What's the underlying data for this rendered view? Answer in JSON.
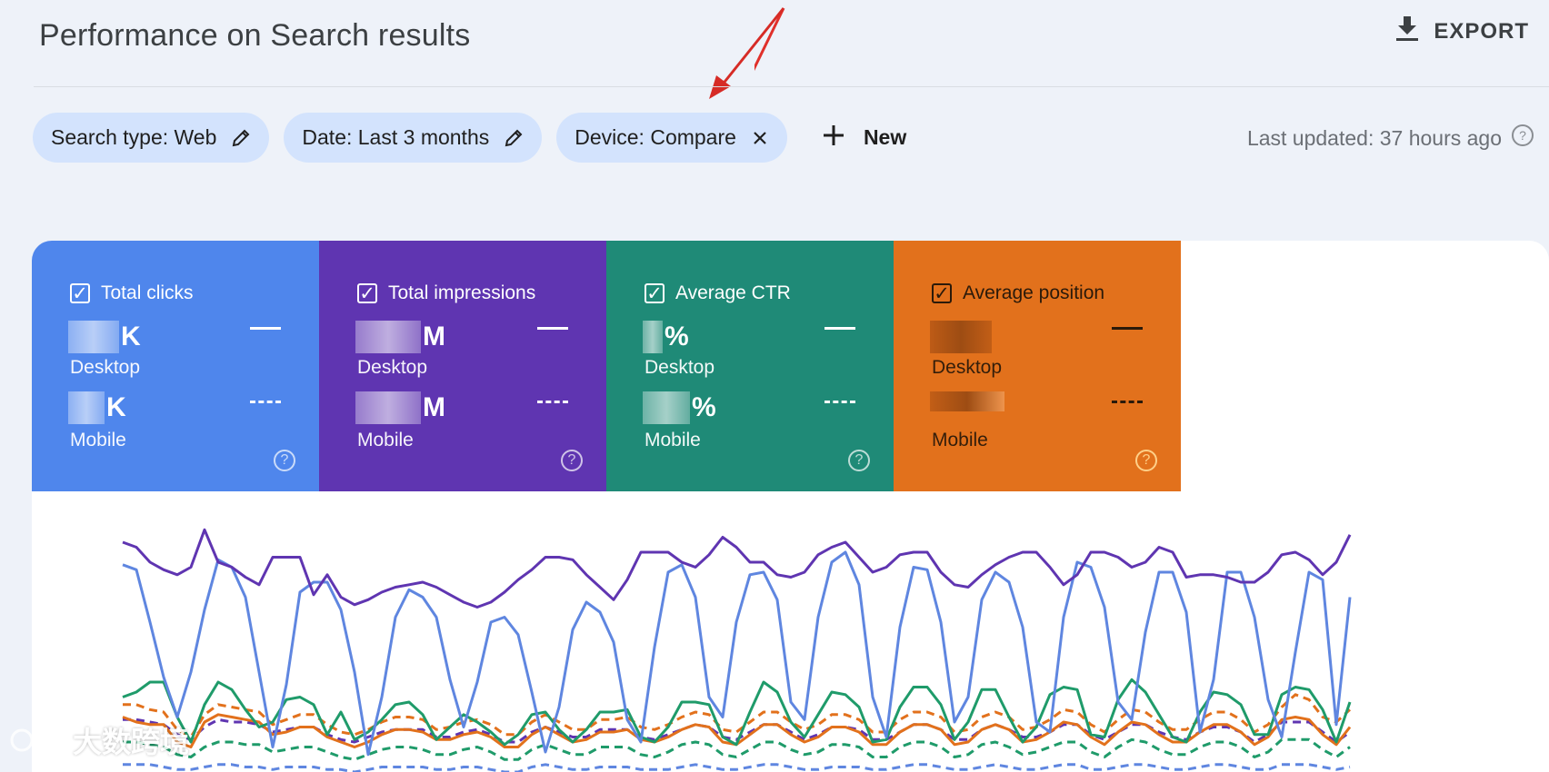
{
  "header": {
    "title": "Performance on Search results",
    "export_label": "EXPORT"
  },
  "filters": {
    "chips": [
      {
        "label": "Search type: Web",
        "icon": "pencil-icon"
      },
      {
        "label": "Date: Last 3 months",
        "icon": "pencil-icon"
      },
      {
        "label": "Device: Compare",
        "icon": "close-icon"
      }
    ],
    "new_label": "New",
    "last_updated": "Last updated: 37 hours ago"
  },
  "metrics": [
    {
      "label": "Total clicks",
      "desktop_suffix": "K",
      "mobile_suffix": "K",
      "desktop_label": "Desktop",
      "mobile_label": "Mobile",
      "color": "#4f86ec"
    },
    {
      "label": "Total impressions",
      "desktop_suffix": "M",
      "mobile_suffix": "M",
      "desktop_label": "Desktop",
      "mobile_label": "Mobile",
      "color": "#5f35b1"
    },
    {
      "label": "Average CTR",
      "desktop_suffix": "%",
      "mobile_suffix": "%",
      "desktop_label": "Desktop",
      "mobile_label": "Mobile",
      "color": "#1f8a77"
    },
    {
      "label": "Average position",
      "desktop_suffix": "",
      "mobile_suffix": "",
      "desktop_label": "Desktop",
      "mobile_label": "Mobile",
      "color": "#e2711c"
    }
  ],
  "watermark": "大数跨境",
  "chart_data": {
    "type": "line",
    "x": [
      1,
      2,
      3,
      4,
      5,
      6,
      7,
      8,
      9,
      10,
      11,
      12,
      13,
      14,
      15,
      16,
      17,
      18,
      19,
      20,
      21,
      22,
      23,
      24,
      25,
      26,
      27,
      28,
      29,
      30,
      31,
      32,
      33,
      34,
      35,
      36,
      37,
      38,
      39,
      40,
      41,
      42,
      43,
      44,
      45,
      46,
      47,
      48,
      49,
      50,
      51,
      52,
      53,
      54,
      55,
      56,
      57,
      58,
      59,
      60,
      61,
      62,
      63,
      64,
      65,
      66,
      67,
      68,
      69,
      70,
      71,
      72,
      73,
      74,
      75,
      76,
      77,
      78,
      79,
      80,
      81,
      82,
      83,
      84,
      85,
      86,
      87,
      88,
      89,
      90,
      91
    ],
    "series": [
      {
        "color": "#5f35b1",
        "dashed": false,
        "values": [
          92,
          90,
          84,
          81,
          79,
          82,
          97,
          84,
          82,
          78,
          75,
          86,
          86,
          86,
          71,
          79,
          70,
          67,
          69,
          72,
          74,
          75,
          76,
          74,
          71,
          68,
          66,
          68,
          72,
          77,
          81,
          86,
          86,
          85,
          79,
          74,
          69,
          77,
          88,
          88,
          88,
          84,
          82,
          87,
          94,
          90,
          84,
          84,
          79,
          78,
          80,
          87,
          90,
          92,
          86,
          80,
          82,
          87,
          88,
          88,
          80,
          75,
          74,
          79,
          83,
          86,
          88,
          88,
          82,
          75,
          79,
          88,
          88,
          86,
          82,
          84,
          90,
          88,
          78,
          79,
          79,
          78,
          76,
          76,
          80,
          87,
          88,
          85,
          79,
          84,
          95
        ]
      },
      {
        "color": "#5f86e0",
        "dashed": false,
        "values": [
          83,
          81,
          60,
          38,
          22,
          40,
          65,
          85,
          82,
          70,
          40,
          10,
          35,
          72,
          76,
          76,
          65,
          40,
          7,
          30,
          62,
          73,
          70,
          62,
          37,
          18,
          36,
          60,
          62,
          55,
          32,
          8,
          26,
          57,
          68,
          64,
          52,
          21,
          12,
          50,
          80,
          83,
          70,
          30,
          22,
          60,
          79,
          80,
          69,
          28,
          21,
          62,
          84,
          88,
          75,
          30,
          14,
          58,
          82,
          81,
          60,
          20,
          30,
          69,
          80,
          76,
          58,
          20,
          16,
          62,
          84,
          82,
          66,
          28,
          21,
          56,
          80,
          80,
          64,
          16,
          37,
          80,
          80,
          62,
          29,
          14,
          48,
          80,
          77,
          19,
          70
        ]
      },
      {
        "color": "#1f9b6a",
        "dashed": false,
        "values": [
          30,
          32,
          36,
          36,
          22,
          12,
          27,
          36,
          33,
          25,
          18,
          20,
          29,
          30,
          27,
          15,
          24,
          13,
          16,
          21,
          27,
          28,
          23,
          13,
          18,
          23,
          20,
          16,
          11,
          15,
          23,
          24,
          17,
          12,
          17,
          24,
          24,
          25,
          14,
          12,
          18,
          28,
          28,
          27,
          14,
          11,
          24,
          36,
          32,
          20,
          14,
          23,
          32,
          31,
          26,
          12,
          13,
          26,
          34,
          34,
          27,
          13,
          20,
          33,
          33,
          22,
          12,
          18,
          31,
          34,
          33,
          15,
          14,
          29,
          37,
          32,
          23,
          14,
          12,
          24,
          32,
          31,
          27,
          15,
          15,
          31,
          34,
          33,
          25,
          12,
          28
        ]
      },
      {
        "color": "#e2711c",
        "dashed": false,
        "values": [
          22,
          20,
          19,
          19,
          12,
          10,
          20,
          23,
          22,
          21,
          20,
          15,
          16,
          18,
          18,
          14,
          12,
          10,
          12,
          15,
          17,
          17,
          16,
          13,
          13,
          15,
          16,
          14,
          10,
          10,
          15,
          18,
          15,
          12,
          13,
          16,
          16,
          17,
          13,
          12,
          14,
          17,
          19,
          18,
          12,
          11,
          15,
          19,
          19,
          15,
          12,
          14,
          18,
          18,
          16,
          11,
          11,
          16,
          19,
          19,
          17,
          11,
          12,
          17,
          19,
          17,
          12,
          13,
          16,
          20,
          19,
          14,
          11,
          16,
          20,
          19,
          15,
          12,
          12,
          16,
          19,
          19,
          16,
          11,
          14,
          21,
          22,
          21,
          15,
          11,
          18
        ]
      },
      {
        "color": "#e2711c",
        "dashed": true,
        "values": [
          27,
          27,
          25,
          24,
          17,
          14,
          23,
          27,
          26,
          25,
          24,
          19,
          21,
          23,
          23,
          19,
          16,
          15,
          17,
          20,
          22,
          22,
          21,
          17,
          18,
          20,
          21,
          19,
          15,
          15,
          20,
          23,
          20,
          17,
          17,
          21,
          21,
          22,
          18,
          17,
          19,
          22,
          24,
          23,
          17,
          16,
          20,
          24,
          24,
          20,
          17,
          19,
          23,
          23,
          21,
          16,
          16,
          21,
          24,
          24,
          22,
          16,
          17,
          22,
          24,
          22,
          17,
          18,
          21,
          25,
          24,
          19,
          16,
          21,
          25,
          24,
          20,
          17,
          17,
          21,
          24,
          24,
          21,
          16,
          19,
          26,
          31,
          29,
          22,
          20,
          25
        ]
      },
      {
        "color": "#5f35b1",
        "dashed": true,
        "values": [
          21,
          21,
          20,
          19,
          15,
          13,
          18,
          21,
          20,
          20,
          19,
          16,
          17,
          18,
          18,
          15,
          13,
          12,
          14,
          16,
          17,
          17,
          17,
          14,
          14,
          16,
          17,
          15,
          12,
          12,
          16,
          18,
          16,
          14,
          14,
          17,
          17,
          17,
          14,
          13,
          15,
          17,
          19,
          18,
          14,
          13,
          16,
          19,
          19,
          16,
          13,
          15,
          18,
          18,
          17,
          13,
          13,
          16,
          19,
          19,
          17,
          13,
          13,
          17,
          19,
          17,
          14,
          14,
          16,
          19,
          19,
          15,
          13,
          16,
          19,
          19,
          16,
          14,
          13,
          16,
          18,
          18,
          16,
          12,
          15,
          20,
          20,
          20,
          16,
          12,
          16
        ]
      },
      {
        "color": "#1f9b6a",
        "dashed": true,
        "values": [
          12,
          12,
          11,
          10,
          7,
          6,
          10,
          12,
          12,
          11,
          11,
          8,
          9,
          10,
          10,
          8,
          6,
          5,
          7,
          9,
          10,
          10,
          9,
          7,
          7,
          9,
          10,
          8,
          5,
          5,
          9,
          11,
          9,
          7,
          7,
          10,
          10,
          10,
          7,
          6,
          8,
          11,
          12,
          11,
          7,
          6,
          9,
          12,
          12,
          9,
          7,
          8,
          11,
          11,
          10,
          6,
          6,
          10,
          12,
          12,
          10,
          6,
          7,
          11,
          12,
          10,
          7,
          8,
          10,
          12,
          12,
          8,
          6,
          10,
          13,
          12,
          9,
          7,
          7,
          10,
          12,
          12,
          10,
          6,
          8,
          13,
          13,
          13,
          9,
          6,
          10
        ]
      },
      {
        "color": "#5f86e0",
        "dashed": true,
        "values": [
          3,
          3,
          3,
          2,
          1,
          1,
          2,
          3,
          3,
          2,
          2,
          1,
          2,
          2,
          2,
          1,
          1,
          0,
          1,
          2,
          2,
          2,
          2,
          1,
          1,
          2,
          2,
          1,
          0,
          0,
          2,
          3,
          2,
          1,
          1,
          2,
          2,
          2,
          1,
          1,
          1,
          2,
          3,
          2,
          1,
          1,
          2,
          3,
          3,
          2,
          1,
          1,
          2,
          2,
          2,
          1,
          1,
          2,
          3,
          3,
          2,
          1,
          1,
          2,
          3,
          2,
          1,
          1,
          2,
          3,
          3,
          1,
          1,
          2,
          3,
          3,
          2,
          1,
          1,
          2,
          3,
          3,
          2,
          1,
          1,
          3,
          3,
          3,
          2,
          1,
          2
        ]
      }
    ],
    "ylim": [
      0,
      100
    ],
    "grid": false
  }
}
